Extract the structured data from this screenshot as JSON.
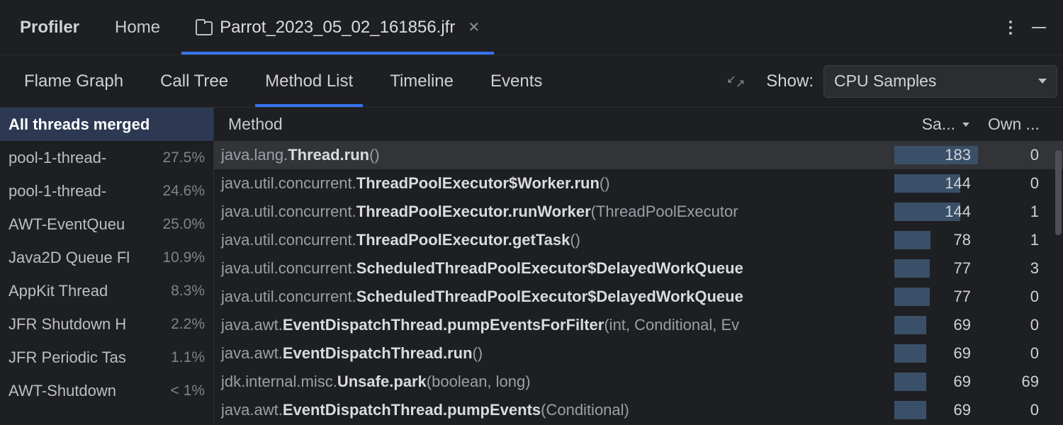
{
  "topbar": {
    "title": "Profiler",
    "home": "Home",
    "file": "Parrot_2023_05_02_161856.jfr"
  },
  "views": {
    "flame": "Flame Graph",
    "calltree": "Call Tree",
    "methodlist": "Method List",
    "timeline": "Timeline",
    "events": "Events",
    "show_label": "Show:",
    "show_value": "CPU Samples"
  },
  "threads": [
    {
      "name": "All threads merged",
      "pct": "",
      "selected": true
    },
    {
      "name": "pool-1-thread-",
      "pct": "27.5%"
    },
    {
      "name": "pool-1-thread-",
      "pct": "24.6%"
    },
    {
      "name": "AWT-EventQueu",
      "pct": "25.0%"
    },
    {
      "name": "Java2D Queue Fl",
      "pct": "10.9%"
    },
    {
      "name": "AppKit Thread",
      "pct": "8.3%"
    },
    {
      "name": "JFR Shutdown H",
      "pct": "2.2%"
    },
    {
      "name": "JFR Periodic Tas",
      "pct": "1.1%"
    },
    {
      "name": "AWT-Shutdown",
      "pct": "< 1%"
    }
  ],
  "columns": {
    "method": "Method",
    "sa": "Sa...",
    "own": "Own ..."
  },
  "methods": [
    {
      "pkg": "java.lang.",
      "cls": "Thread.run",
      "args": "()",
      "sa": 183,
      "own": 0,
      "bar": 100,
      "truncated": false,
      "selected": true
    },
    {
      "pkg": "java.util.concurrent.",
      "cls": "ThreadPoolExecutor$Worker.run",
      "args": "()",
      "sa": 144,
      "own": 0,
      "bar": 79,
      "truncated": false
    },
    {
      "pkg": "java.util.concurrent.",
      "cls": "ThreadPoolExecutor.runWorker",
      "args": "(ThreadPoolExecutor",
      "sa": 144,
      "own": 1,
      "bar": 79,
      "truncated": true
    },
    {
      "pkg": "java.util.concurrent.",
      "cls": "ThreadPoolExecutor.getTask",
      "args": "()",
      "sa": 78,
      "own": 1,
      "bar": 43,
      "truncated": false
    },
    {
      "pkg": "java.util.concurrent.",
      "cls": "ScheduledThreadPoolExecutor$DelayedWorkQueue",
      "args": "",
      "sa": 77,
      "own": 3,
      "bar": 42,
      "truncated": true
    },
    {
      "pkg": "java.util.concurrent.",
      "cls": "ScheduledThreadPoolExecutor$DelayedWorkQueue",
      "args": "",
      "sa": 77,
      "own": 0,
      "bar": 42,
      "truncated": true
    },
    {
      "pkg": "java.awt.",
      "cls": "EventDispatchThread.pumpEventsForFilter",
      "args": "(int, Conditional, Ev",
      "sa": 69,
      "own": 0,
      "bar": 38,
      "truncated": true
    },
    {
      "pkg": "java.awt.",
      "cls": "EventDispatchThread.run",
      "args": "()",
      "sa": 69,
      "own": 0,
      "bar": 38,
      "truncated": false
    },
    {
      "pkg": "jdk.internal.misc.",
      "cls": "Unsafe.park",
      "args": "(boolean, long)",
      "sa": 69,
      "own": 69,
      "bar": 38,
      "truncated": false
    },
    {
      "pkg": "java.awt.",
      "cls": "EventDispatchThread.pumpEvents",
      "args": "(Conditional)",
      "sa": 69,
      "own": 0,
      "bar": 38,
      "truncated": false
    }
  ]
}
